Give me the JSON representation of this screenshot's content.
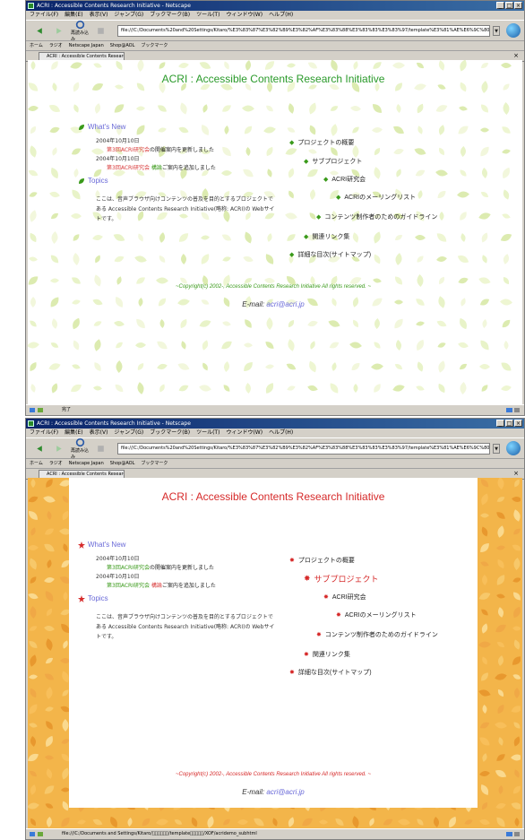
{
  "browser": {
    "window_title": "ACRI : Accessible Contents Research Initiative - Netscape",
    "menu": [
      "ファイル(F)",
      "編集(E)",
      "表示(V)",
      "ジャンプ(G)",
      "ブックマーク(B)",
      "ツール(T)",
      "ウィンドウ(W)",
      "ヘルプ(H)"
    ],
    "nav_reload_label": "再読み込み",
    "url_top": "file:///C:/Documents%20and%20Settings/Kitaro/%E3%83%87%E3%82%B9%E3%82%AF%E3%83%88%E3%83%83%E3%83%97/template%E3%81%AE%E6%9C%80%E7%B5%82%E7%89%88/XOF/acridemo5",
    "url_bottom": "file:///C:/Documents%20and%20Settings/Kitaro/%E3%83%87%E3%82%B9%E3%82%AF%E3%83%88%E3%83%83%E3%83%97/template%E3%81%AE%E6%9C%80%E7%B5%82%E7%89%88/XOF/acridemo2",
    "bookmarks": [
      "ホーム",
      "ラジオ",
      "Netscape Japan",
      "Shop@AOL",
      "ブックマーク"
    ],
    "tab_label": "ACRI : Accessible Contents Research In...",
    "status_top": "完了",
    "status_bottom": "file:///C:/Documents and Settings/Kitaro/\u0000\u0000\u0000\u0000\u0000\u0000/template\u0000\u0000\u0000\u0000\u0000/XOF/acridemo_subhtml"
  },
  "page": {
    "title": "ACRI : Accessible Contents Research Initiative",
    "whats_new_heading": "What's New",
    "news": [
      {
        "date": "2004年10月10日",
        "link": "第3回ACRI研究会",
        "text": "の開催案内を更新しました"
      },
      {
        "date": "2004年10月10日",
        "link": "第3回ACRI研究会",
        "link2": "構論",
        "text": "ご案内を追加しました"
      }
    ],
    "topics_heading": "Topics",
    "topics_text": "ここは、音声ブラウザ向けコンテンツの普及を目的とするプロジェクトである Accessible Contents Research Initiative(略称: ACRI)の Webサイトです。",
    "sitemap": [
      "プロジェクトの概要",
      "サブプロジェクト",
      "ACRI研究会",
      "ACRIのメーリングリスト",
      "コンテンツ制作者のためのガイドライン",
      "関連リンク集",
      "詳細な目次(サイトマップ)"
    ],
    "copyright": "~Copyright(c) 2002-, Accessible Contents Research Initiative All rights reserved. ~",
    "email_label": "E-mail:",
    "email_address": "acri@acri.jp"
  },
  "theme": {
    "green_accent": "#3a9a1a",
    "green_link": "#6a6ad8",
    "orange_bg": "#f3b54a",
    "red_accent": "#d62a2a",
    "title_color_top": "#2a9a2a",
    "title_color_bottom": "#d62a2a"
  }
}
